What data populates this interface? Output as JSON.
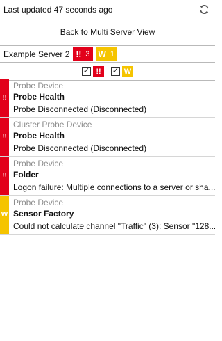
{
  "header": {
    "last_updated": "Last updated 47 seconds ago",
    "refresh_icon": "refresh-icon"
  },
  "nav": {
    "back_label": "Back to Multi Server View"
  },
  "server": {
    "name": "Example Server 2",
    "error_symbol": "!!",
    "error_count": "3",
    "warning_symbol": "W",
    "warning_count": "1"
  },
  "filters": {
    "errors_checked": true,
    "warnings_checked": true,
    "error_symbol": "!!",
    "warning_symbol": "W"
  },
  "alerts": [
    {
      "severity": "error",
      "symbol": "!!",
      "source": "Probe Device",
      "title": "Probe Health",
      "message": "Probe Disconnected (Disconnected)"
    },
    {
      "severity": "error",
      "symbol": "!!",
      "source": "Cluster Probe Device",
      "title": "Probe Health",
      "message": "Probe Disconnected (Disconnected)"
    },
    {
      "severity": "error",
      "symbol": "!!",
      "source": "Probe Device",
      "title": "Folder",
      "message": "Logon failure: Multiple connections to a server or sha..."
    },
    {
      "severity": "warning",
      "symbol": "W",
      "source": "Probe Device",
      "title": "Sensor Factory",
      "message": "Could not calculate channel \"Traffic\" (3): Sensor \"128..."
    }
  ],
  "colors": {
    "error": "#e2001a",
    "warning": "#f5c400",
    "muted_text": "#8c8c8c",
    "divider": "#b9b9b9"
  }
}
